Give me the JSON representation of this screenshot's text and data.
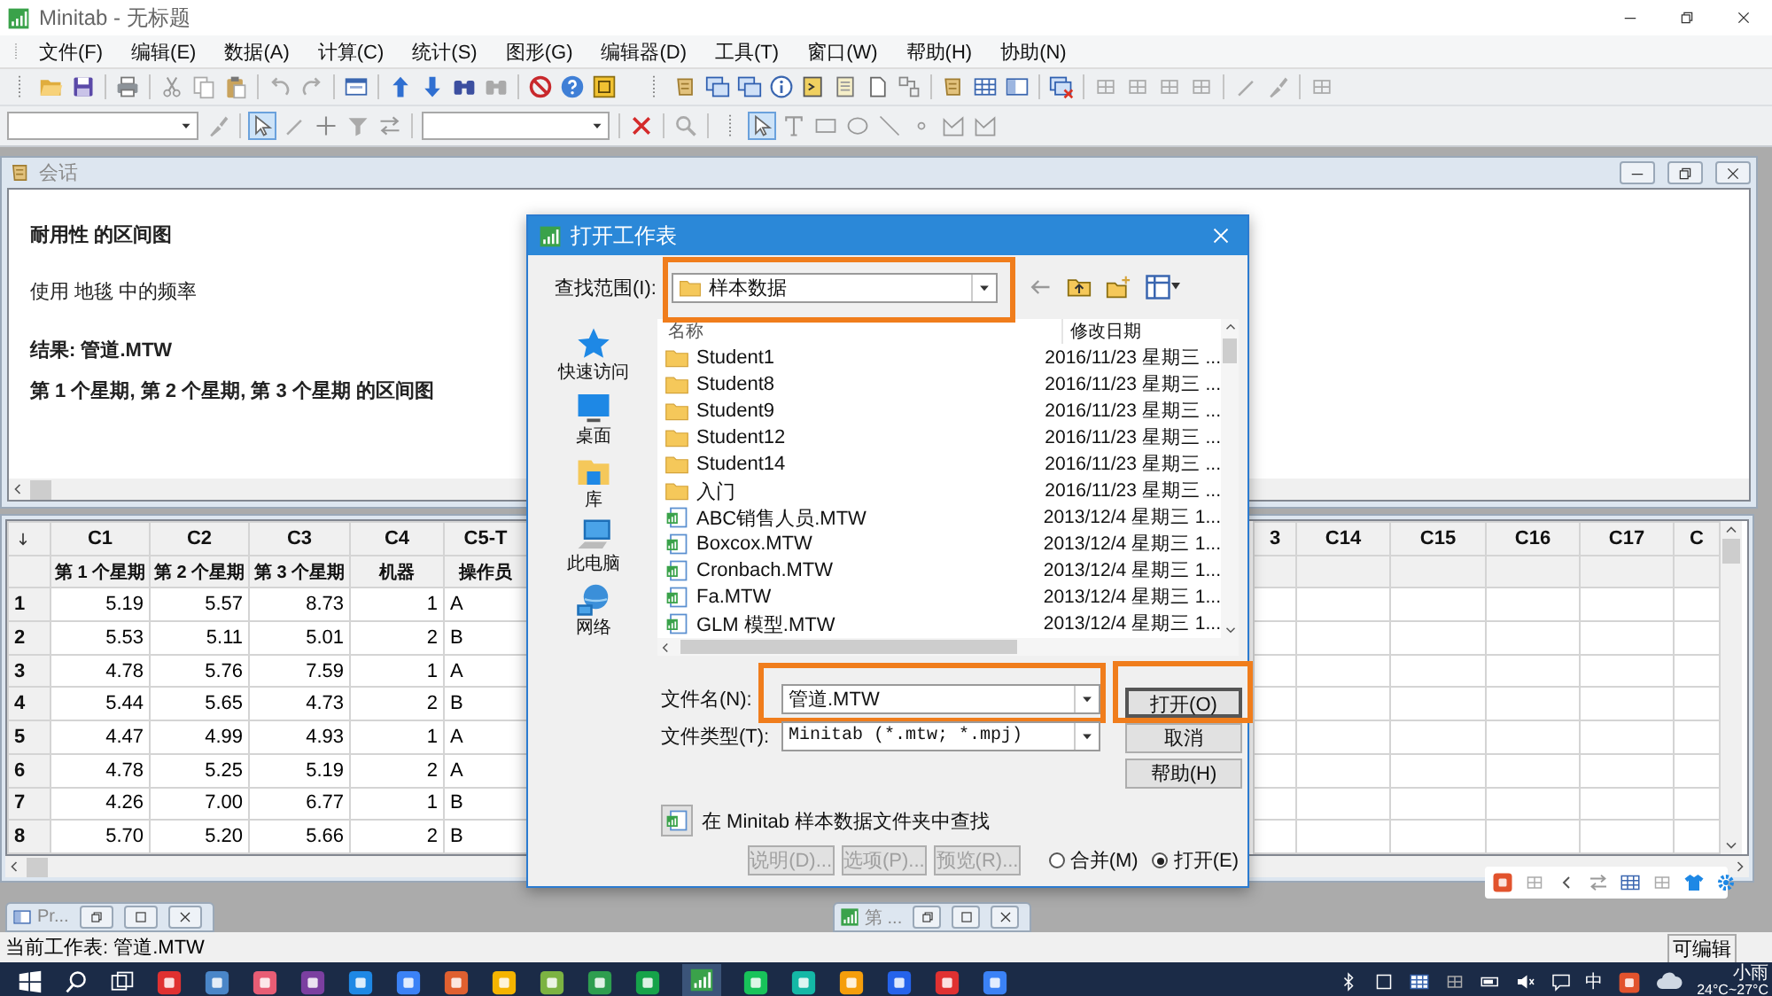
{
  "window": {
    "title": "Minitab - 无标题"
  },
  "menu": [
    "文件(F)",
    "编辑(E)",
    "数据(A)",
    "计算(C)",
    "统计(S)",
    "图形(G)",
    "编辑器(D)",
    "工具(T)",
    "窗口(W)",
    "帮助(H)",
    "协助(N)"
  ],
  "session": {
    "title": "会话",
    "lines": [
      {
        "text": "耐用性 的区间图",
        "bold": true
      },
      {
        "text": "使用 地毯 中的频率",
        "bold": false
      },
      {
        "text": "结果: 管道.MTW",
        "bold": true
      },
      {
        "text": "第 1 个星期, 第 2 个星期, 第 3 个星期 的区间图",
        "bold": true
      }
    ]
  },
  "worksheet": {
    "columns": [
      {
        "id": "C1",
        "name": "第 1 个星期",
        "kind": "numeric"
      },
      {
        "id": "C2",
        "name": "第 2 个星期",
        "kind": "numeric"
      },
      {
        "id": "C3",
        "name": "第 3 个星期",
        "kind": "numeric"
      },
      {
        "id": "C4",
        "name": "机器",
        "kind": "numeric"
      },
      {
        "id": "C5-T",
        "name": "操作员",
        "kind": "text"
      }
    ],
    "more_columns": [
      "3",
      "C14",
      "C15",
      "C16",
      "C17",
      "C"
    ],
    "rows": [
      {
        "number": "1",
        "cells": [
          "5.19",
          "5.57",
          "8.73",
          "1",
          "A"
        ]
      },
      {
        "number": "2",
        "cells": [
          "5.53",
          "5.11",
          "5.01",
          "2",
          "B"
        ]
      },
      {
        "number": "3",
        "cells": [
          "4.78",
          "5.76",
          "7.59",
          "1",
          "A"
        ]
      },
      {
        "number": "4",
        "cells": [
          "5.44",
          "5.65",
          "4.73",
          "2",
          "B"
        ]
      },
      {
        "number": "5",
        "cells": [
          "4.47",
          "4.99",
          "4.93",
          "1",
          "A"
        ]
      },
      {
        "number": "6",
        "cells": [
          "4.78",
          "5.25",
          "5.19",
          "2",
          "A"
        ]
      },
      {
        "number": "7",
        "cells": [
          "4.26",
          "7.00",
          "6.77",
          "1",
          "B"
        ]
      },
      {
        "number": "8",
        "cells": [
          "5.70",
          "5.20",
          "5.66",
          "2",
          "B"
        ]
      }
    ]
  },
  "minimized": [
    "Pr...",
    "第 ..."
  ],
  "dialog": {
    "title": "打开工作表",
    "look_in": {
      "label": "查找范围(I):",
      "value": "样本数据",
      "highlighted": true
    },
    "places": [
      "快速访问",
      "桌面",
      "库",
      "此电脑",
      "网络"
    ],
    "columns": [
      "名称",
      "修改日期"
    ],
    "files": [
      {
        "name": "Student1",
        "date": "2016/11/23 星期三 ...",
        "kind": "folder"
      },
      {
        "name": "Student8",
        "date": "2016/11/23 星期三 ...",
        "kind": "folder"
      },
      {
        "name": "Student9",
        "date": "2016/11/23 星期三 ...",
        "kind": "folder"
      },
      {
        "name": "Student12",
        "date": "2016/11/23 星期三 ...",
        "kind": "folder"
      },
      {
        "name": "Student14",
        "date": "2016/11/23 星期三 ...",
        "kind": "folder"
      },
      {
        "name": "入门",
        "date": "2016/11/23 星期三 ...",
        "kind": "folder"
      },
      {
        "name": "ABC销售人员.MTW",
        "date": "2013/12/4 星期三 1...",
        "kind": "worksheet"
      },
      {
        "name": "Boxcox.MTW",
        "date": "2013/12/4 星期三 1...",
        "kind": "worksheet"
      },
      {
        "name": "Cronbach.MTW",
        "date": "2013/12/4 星期三 1...",
        "kind": "worksheet"
      },
      {
        "name": "Fa.MTW",
        "date": "2013/12/4 星期三 1...",
        "kind": "worksheet"
      },
      {
        "name": "GLM 模型.MTW",
        "date": "2013/12/4 星期三 1...",
        "kind": "worksheet"
      }
    ],
    "file_name": {
      "label": "文件名(N):",
      "value": "管道.MTW",
      "highlighted": true
    },
    "file_type": {
      "label": "文件类型(T):",
      "value": "Minitab (*.mtw; *.mpj)",
      "highlighted": false
    },
    "buttons": [
      {
        "label": "打开(O)",
        "highlighted": true
      },
      {
        "label": "取消",
        "highlighted": false
      },
      {
        "label": "帮助(H)",
        "highlighted": false
      }
    ],
    "sample_search": "在 Minitab 样本数据文件夹中查找",
    "option_buttons": [
      {
        "label": "说明(D)...",
        "disabled": true
      },
      {
        "label": "选项(P)...",
        "disabled": true
      },
      {
        "label": "预览(R)...",
        "disabled": true
      }
    ],
    "modes": [
      {
        "label": "合并(M)",
        "selected": false
      },
      {
        "label": "打开(E)",
        "selected": true
      }
    ]
  },
  "status_bar": {
    "worksheet": "当前工作表: 管道.MTW",
    "mode": "可编辑"
  },
  "taskbar": {
    "ime": "中",
    "weather": "小雨",
    "temperature": "24°C~27°C"
  }
}
